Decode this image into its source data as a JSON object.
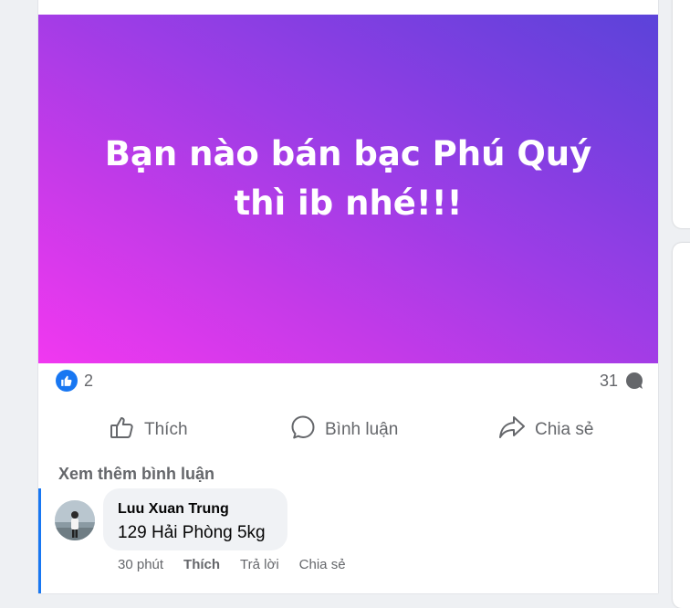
{
  "post": {
    "banner_text": "Bạn nào bán bạc Phú Quý thì ib nhé!!!",
    "banner_colors": {
      "start": "#f138f0",
      "end": "#5b43d9"
    },
    "like_count": "2",
    "comment_count": "31"
  },
  "actions": {
    "like_label": "Thích",
    "comment_label": "Bình luận",
    "share_label": "Chia sẻ"
  },
  "comments": {
    "view_more_label": "Xem thêm bình luận",
    "items": [
      {
        "author": "Luu Xuan Trung",
        "text": "129 Hải Phòng 5kg",
        "time": "30 phút",
        "like_label": "Thích",
        "reply_label": "Trả lời",
        "share_label": "Chia sẻ"
      }
    ]
  },
  "colors": {
    "accent": "#1877f2",
    "secondary_text": "#65676b",
    "bubble_bg": "#f0f2f5"
  }
}
